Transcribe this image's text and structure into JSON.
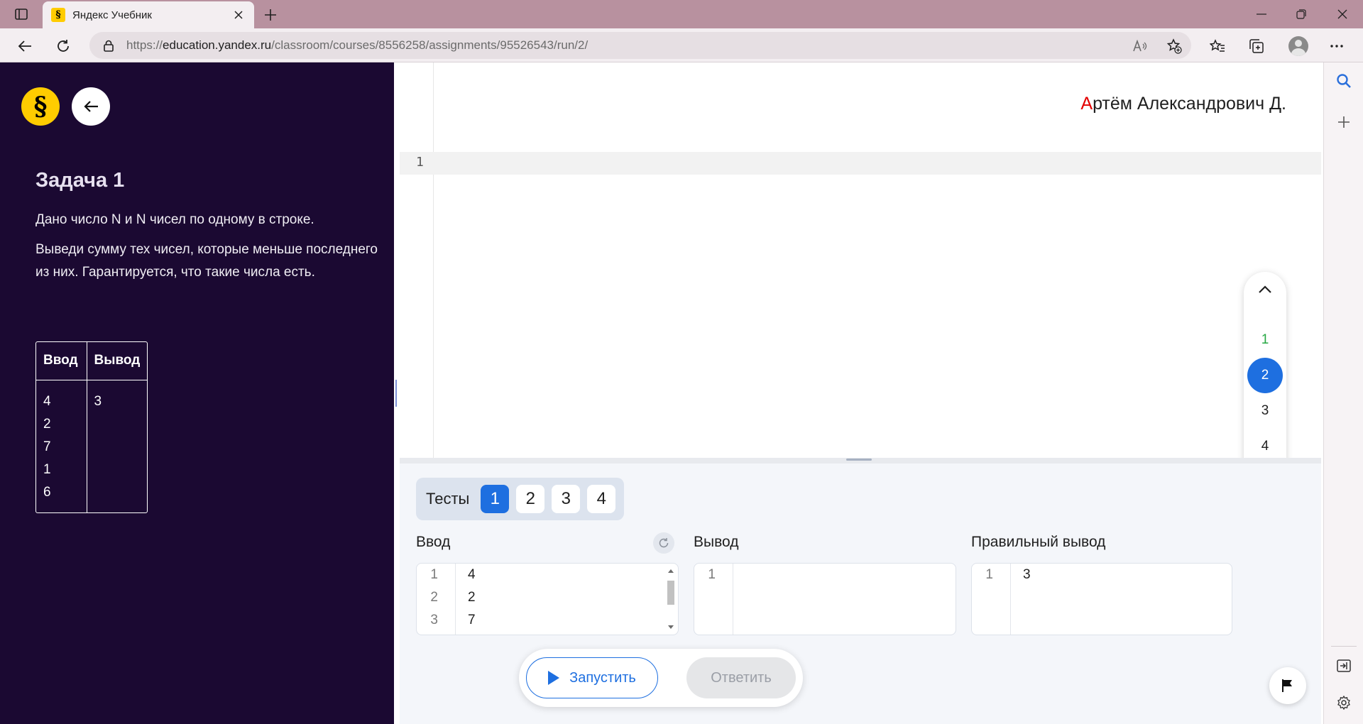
{
  "browser": {
    "tab_title": "Яндекс Учебник",
    "url_scheme": "https://",
    "url_host": "education.yandex.ru",
    "url_path": "/classroom/courses/8556258/assignments/95526543/run/2/"
  },
  "task": {
    "title": "Задача 1",
    "paragraphs": [
      "Дано число N и N чисел по одному в строке.",
      "Выведи сумму тех чисел, которые меньше последнего из них. Гарантируется, что такие числа есть."
    ],
    "example": {
      "input_header": "Ввод",
      "output_header": "Вывод",
      "input_lines": [
        "4",
        "2",
        "7",
        "1",
        "6"
      ],
      "output_lines": [
        "3"
      ]
    }
  },
  "editor": {
    "student_first_letter": "А",
    "student_rest": "ртём Александрович Д.",
    "line_number": "1"
  },
  "task_nav": {
    "items": [
      "1",
      "2",
      "3",
      "4"
    ],
    "active_index": 1,
    "done_index": 0
  },
  "tests": {
    "label": "Тесты",
    "tabs": [
      "1",
      "2",
      "3",
      "4"
    ],
    "active_index": 0,
    "input_title": "Ввод",
    "output_title": "Вывод",
    "expected_title": "Правильный вывод",
    "input_lines": [
      "4",
      "2",
      "7"
    ],
    "input_numbers": [
      "1",
      "2",
      "3"
    ],
    "output_numbers": [
      "1"
    ],
    "expected_numbers": [
      "1"
    ],
    "expected_lines": [
      "3"
    ]
  },
  "actions": {
    "run_label": "Запустить",
    "answer_label": "Ответить"
  },
  "colors": {
    "sidebar_bg": "#1b0932",
    "accent_blue": "#1e6fe0",
    "logo_yellow": "#ffcc00",
    "done_green": "#27a844"
  }
}
